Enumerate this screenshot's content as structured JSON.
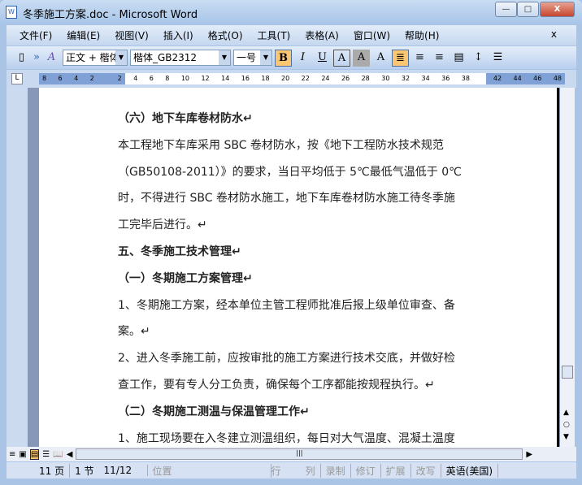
{
  "window": {
    "title": "冬季施工方案.doc - Microsoft Word",
    "icon": "W",
    "min": "—",
    "max": "□",
    "close": "X"
  },
  "menu": [
    "文件(F)",
    "编辑(E)",
    "视图(V)",
    "插入(I)",
    "格式(O)",
    "工具(T)",
    "表格(A)",
    "窗口(W)",
    "帮助(H)"
  ],
  "menu_close": "x",
  "toolbar": {
    "style": "正文 + 楷体",
    "font": "楷体_GB2312",
    "size": "一号",
    "bold": "B",
    "italic": "I",
    "underline": "U",
    "charborder": "A",
    "charshade": "A",
    "scale": "A"
  },
  "ruler": [
    "8",
    "6",
    "4",
    "2",
    "",
    "2",
    "4",
    "6",
    "8",
    "10",
    "12",
    "14",
    "16",
    "18",
    "20",
    "22",
    "24",
    "26",
    "28",
    "30",
    "32",
    "34",
    "36",
    "38",
    "",
    "42",
    "44",
    "46",
    "48"
  ],
  "document": [
    {
      "text": "（六）地下车库卷材防水↵",
      "bold": true
    },
    {
      "text": "本工程地下车库采用 SBC 卷材防水，按《地下工程防水技术规范",
      "bold": false
    },
    {
      "text": "（GB50108-2011）》的要求，当日平均低于 5℃最低气温低于 0℃",
      "bold": false
    },
    {
      "text": "时，不得进行 SBC 卷材防水施工，地下车库卷材防水施工待冬季施",
      "bold": false
    },
    {
      "text": "工完毕后进行。↵",
      "bold": false
    },
    {
      "text": "五、冬季施工技术管理↵",
      "bold": true
    },
    {
      "text": "（一）冬期施工方案管理↵",
      "bold": true
    },
    {
      "text": "1、冬期施工方案，经本单位主管工程师批准后报上级单位审查、备",
      "bold": false
    },
    {
      "text": "案。↵",
      "bold": false
    },
    {
      "text": "2、进入冬季施工前，应按审批的施工方案进行技术交底，并做好检",
      "bold": false
    },
    {
      "text": "查工作，要有专人分工负责，确保每个工序都能按规程执行。↵",
      "bold": false
    },
    {
      "text": "（二）冬期施工测温与保温管理工作↵",
      "bold": true
    },
    {
      "text": "1、施工现场要在入冬建立测温组织，每日对大气温度、混凝土温度",
      "bold": false
    }
  ],
  "status": {
    "page": "11 页",
    "section": "1 节",
    "pages": "11/12",
    "position": "位置",
    "line": "行",
    "col": "列",
    "rec": "录制",
    "trk": "修订",
    "ext": "扩展",
    "ovr": "改写",
    "lang": "英语(美国)"
  }
}
